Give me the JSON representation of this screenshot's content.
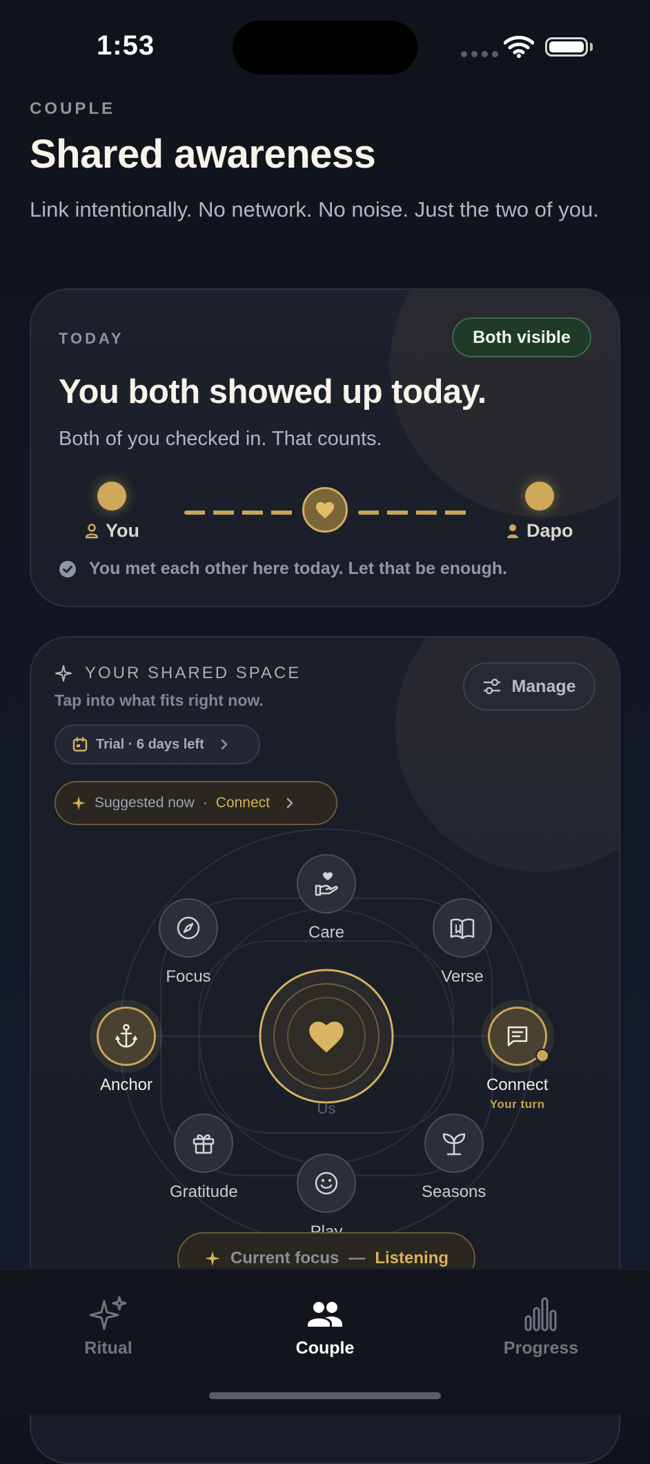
{
  "status_bar": {
    "time": "1:53"
  },
  "header": {
    "eyebrow": "COUPLE",
    "title": "Shared awareness",
    "subtitle": "Link intentionally. No network. No noise. Just the two of you."
  },
  "today": {
    "label": "TODAY",
    "badge": "Both visible",
    "heading": "You both showed up today.",
    "subtext": "Both of you checked in. That counts.",
    "you_label": "You",
    "partner_label": "Dapo",
    "met_message": "You met each other here today. Let that be enough."
  },
  "shared_space": {
    "title": "YOUR SHARED SPACE",
    "subtitle": "Tap into what fits right now.",
    "manage_label": "Manage",
    "trial_label": "Trial · 6 days left",
    "suggested_label": "Suggested now",
    "suggested_separator": "·",
    "suggested_value": "Connect",
    "nodes": {
      "care": "Care",
      "focus": "Focus",
      "verse": "Verse",
      "anchor": "Anchor",
      "connect": "Connect",
      "connect_status": "Your turn",
      "gratitude": "Gratitude",
      "seasons": "Seasons",
      "play": "Play",
      "center": "Us"
    },
    "current_focus_label": "Current focus",
    "current_focus_separator": "—",
    "current_focus_value": "Listening"
  },
  "tabs": [
    {
      "label": "Ritual",
      "icon": "sparkles-icon"
    },
    {
      "label": "Couple",
      "icon": "people-icon"
    },
    {
      "label": "Progress",
      "icon": "bar-chart-icon"
    }
  ],
  "colors": {
    "accent_gold": "#cfa959",
    "badge_green": "#1f3a28",
    "background": "#0f131b"
  }
}
